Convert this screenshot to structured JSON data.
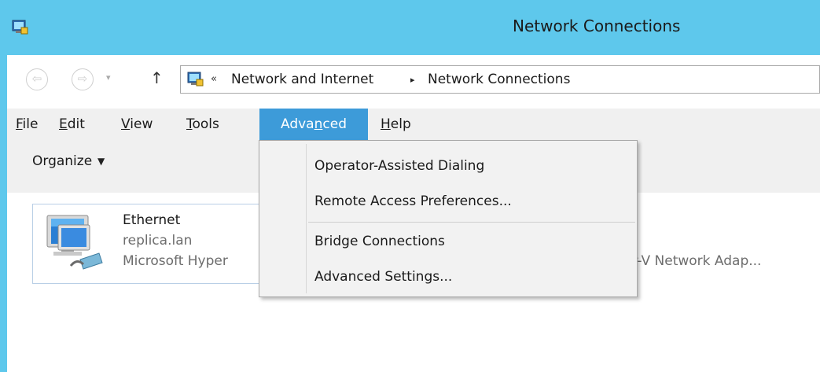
{
  "window": {
    "title": "Network Connections"
  },
  "address": {
    "overflow": "«",
    "crumbs": [
      "Network and Internet",
      "Network Connections"
    ],
    "separator": "▸"
  },
  "nav": {
    "back": "⇦",
    "forward": "⇨",
    "dropdown": "▾",
    "up": "↑"
  },
  "menu": {
    "file": {
      "pre": "",
      "key": "F",
      "post": "ile"
    },
    "edit": {
      "pre": "",
      "key": "E",
      "post": "dit"
    },
    "view": {
      "pre": "",
      "key": "V",
      "post": "iew"
    },
    "tools": {
      "pre": "",
      "key": "T",
      "post": "ools"
    },
    "advanced": {
      "pre": "Adva",
      "key": "n",
      "post": "ced"
    },
    "help": {
      "pre": "",
      "key": "H",
      "post": "elp"
    }
  },
  "toolbar": {
    "organize": "Organize",
    "organize_arrow": "▼"
  },
  "advanced_menu": {
    "items": [
      "Operator-Assisted Dialing",
      "Remote Access Preferences...",
      "Bridge Connections",
      "Advanced Settings..."
    ]
  },
  "connections": [
    {
      "name": "Ethernet",
      "domain": "replica.lan",
      "adapter": "Microsoft Hyper"
    },
    {
      "adapter_tail": "er-V Network Adap..."
    }
  ],
  "colors": {
    "titlebar": "#5ec8ec",
    "menu_highlight": "#3d9bd9",
    "band": "#f0f0f0"
  }
}
